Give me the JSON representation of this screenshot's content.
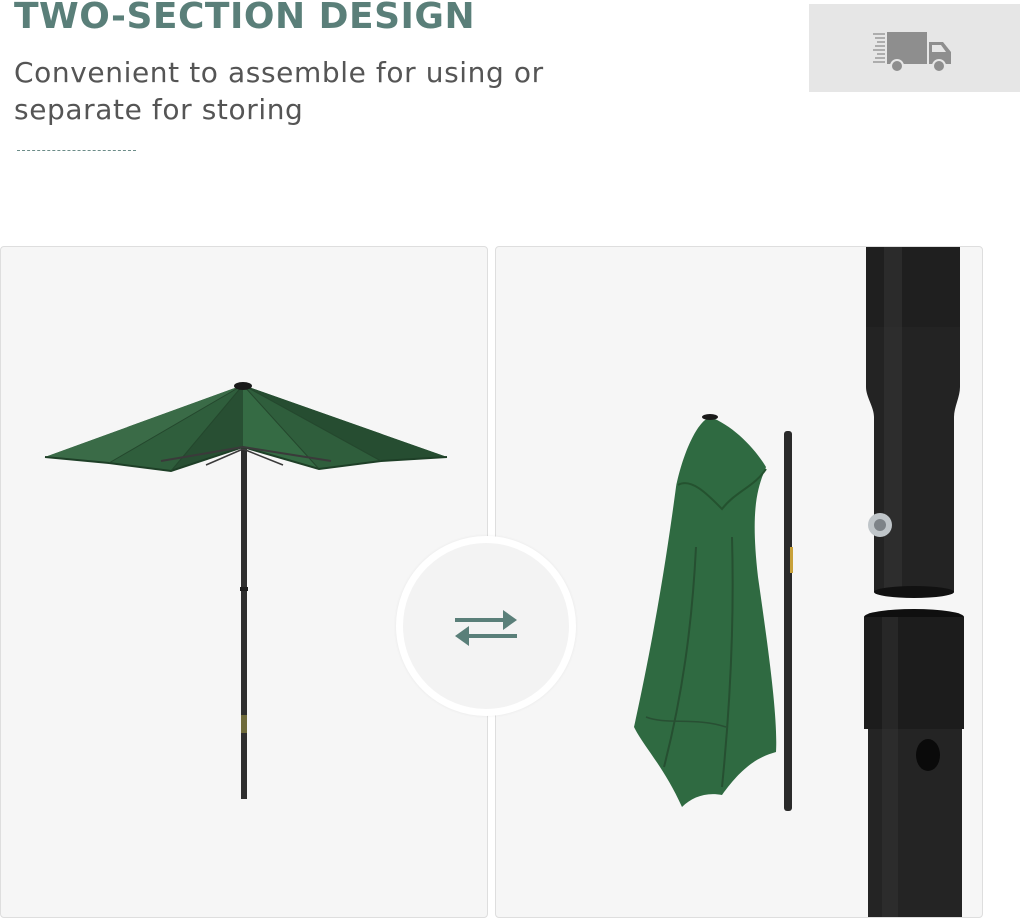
{
  "heading": {
    "title": "TWO-SECTION DESIGN",
    "description": "Convenient to assemble for using or separate for storing"
  },
  "icons": {
    "delivery": "delivery-truck-icon",
    "swap": "swap-arrows-icon"
  },
  "colors": {
    "accent": "#5a7f79",
    "canopy": "#2f5e3c",
    "pole": "#2a2a2a"
  }
}
